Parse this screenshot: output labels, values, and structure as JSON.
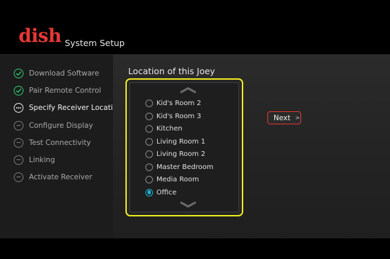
{
  "header": {
    "logo_text": "dish",
    "title": "System Setup",
    "brand_color": "#e53935"
  },
  "sidebar": {
    "steps": [
      {
        "label": "Download Software",
        "status": "done",
        "icon": "check-circle-icon"
      },
      {
        "label": "Pair Remote Control",
        "status": "done",
        "icon": "check-circle-icon"
      },
      {
        "label": "Specify Receiver Location",
        "status": "current",
        "icon": "ellipsis-circle-icon"
      },
      {
        "label": "Configure Display",
        "status": "pending",
        "icon": "dash-circle-icon"
      },
      {
        "label": "Test Connectivity",
        "status": "pending",
        "icon": "dash-circle-icon"
      },
      {
        "label": "Linking",
        "status": "pending",
        "icon": "dash-circle-icon"
      },
      {
        "label": "Activate Receiver",
        "status": "pending",
        "icon": "dash-circle-icon"
      }
    ]
  },
  "main": {
    "section_title": "Location of this Joey",
    "options": [
      {
        "label": "Kid's Room 2",
        "selected": false
      },
      {
        "label": "Kid's Room 3",
        "selected": false
      },
      {
        "label": "Kitchen",
        "selected": false
      },
      {
        "label": "Living Room 1",
        "selected": false
      },
      {
        "label": "Living Room 2",
        "selected": false
      },
      {
        "label": "Master Bedroom",
        "selected": false
      },
      {
        "label": "Media Room",
        "selected": false
      },
      {
        "label": "Office",
        "selected": true
      }
    ],
    "highlight_color": "#f4ee1e",
    "selected_color": "#1fb3d6",
    "next_button": {
      "label": "Next",
      "arrow": ">"
    }
  }
}
